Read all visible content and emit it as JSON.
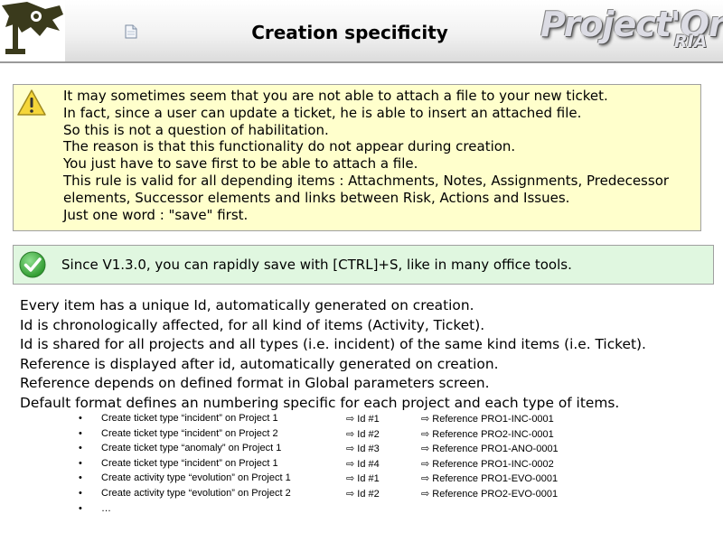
{
  "header": {
    "title": "Creation specificity",
    "brand_main": "Project'Or",
    "brand_sub": "RIA"
  },
  "colors": {
    "warning_bg": "#ffffcc",
    "tip_bg": "#e0f7e0",
    "warning_icon": "#f5d63a",
    "tip_icon": "#3fae3f"
  },
  "icons": {
    "corner": "project-logo-icon",
    "page": "document-icon",
    "warning": "warning-triangle-icon",
    "tip": "check-circle-icon",
    "arrow": "arrow-right-icon"
  },
  "warning": {
    "lines": [
      "It may sometimes seem that you are not able to attach a file to your new ticket.",
      "In fact, since a user can update a ticket, he is able to insert an attached file.",
      "So this is not a question of habilitation.",
      "The reason is that this functionality do not appear during creation.",
      "You just have to save first to be able to attach a file.",
      "This rule is valid for all depending items : Attachments, Notes, Assignments, Predecessor elements, Successor elements and links between Risk, Actions and Issues.",
      "Just one word : \"save\" first."
    ]
  },
  "tip": {
    "text": "Since V1.3.0, you can rapidly save with [CTRL]+S, like in many office tools."
  },
  "body": {
    "lines": [
      "Every item has a unique Id, automatically generated on creation.",
      "Id is chronologically affected, for all kind of items (Activity, Ticket).",
      "Id is shared for all projects and all types (i.e. incident) of the same kind items (i.e. Ticket).",
      "Reference is displayed after id, automatically generated on creation.",
      "Reference depends on defined format in Global parameters screen.",
      "Default format defines an numbering specific for each project and each type of items."
    ]
  },
  "examples": {
    "bullet": "•",
    "arrow": "⇨",
    "rows": [
      {
        "action": "Create ticket type “incident” on Project 1",
        "id": "Id #1",
        "reference": "Reference PRO1-INC-0001"
      },
      {
        "action": "Create ticket type “incident” on Project 2",
        "id": "Id #2",
        "reference": "Reference PRO2-INC-0001"
      },
      {
        "action": "Create ticket type “anomaly” on Project 1",
        "id": "Id #3",
        "reference": "Reference PRO1-ANO-0001"
      },
      {
        "action": "Create ticket type “incident” on Project 1",
        "id": "Id #4",
        "reference": "Reference PRO1-INC-0002"
      },
      {
        "action": "Create activity type “evolution” on Project 1",
        "id": "Id #1",
        "reference": "Reference PRO1-EVO-0001"
      },
      {
        "action": "Create activity type “evolution” on Project 2",
        "id": "Id #2",
        "reference": "Reference PRO2-EVO-0001"
      }
    ],
    "ellipsis": "…"
  }
}
